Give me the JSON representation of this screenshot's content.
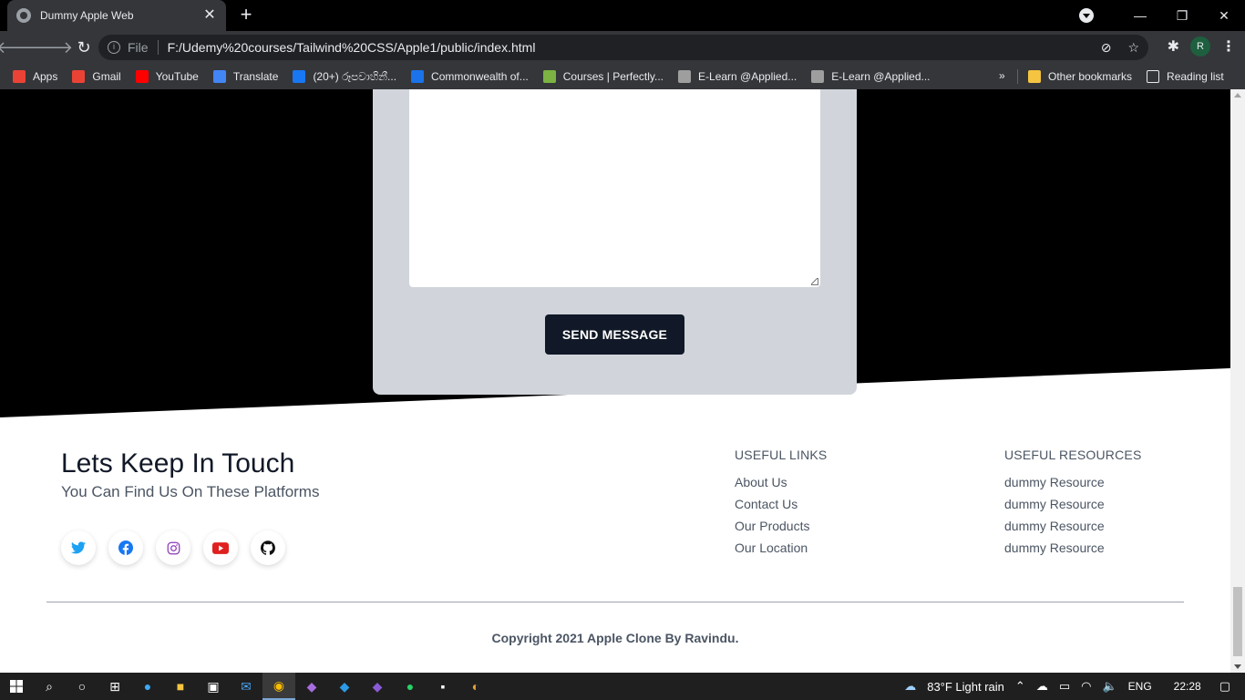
{
  "browser": {
    "tab_title": "Dummy Apple Web",
    "tab_close": "✕",
    "new_tab": "+",
    "scheme_label": "File",
    "url": "F:/Udemy%20courses/Tailwind%20CSS/Apple1/public/index.html",
    "profile_initial": "R",
    "bookmarks": [
      {
        "label": "Apps",
        "color": "#ea4335"
      },
      {
        "label": "Gmail",
        "color": "#ea4335"
      },
      {
        "label": "YouTube",
        "color": "#ff0000"
      },
      {
        "label": "Translate",
        "color": "#4285f4"
      },
      {
        "label": "(20+) රූපවාහිනී...",
        "color": "#1877f2"
      },
      {
        "label": "Commonwealth of...",
        "color": "#1a73e8"
      },
      {
        "label": "Courses | Perfectly...",
        "color": "#7cb342"
      },
      {
        "label": "E-Learn @Applied...",
        "color": "#9e9e9e"
      },
      {
        "label": "E-Learn @Applied...",
        "color": "#9e9e9e"
      }
    ],
    "bookmarks_more": "»",
    "other_bookmarks": "Other bookmarks",
    "reading_list": "Reading list"
  },
  "form": {
    "send_label": "SEND MESSAGE"
  },
  "footer": {
    "title": "Lets Keep In Touch",
    "subtitle": "You Can Find Us On These Platforms",
    "socials": [
      {
        "name": "twitter",
        "color": "#1da1f2"
      },
      {
        "name": "facebook",
        "color": "#1877f2"
      },
      {
        "name": "instagram",
        "color": "#8a3ab9"
      },
      {
        "name": "youtube",
        "color": "#e02020"
      },
      {
        "name": "github",
        "color": "#111111"
      }
    ],
    "useful_links": {
      "heading": "Useful Links",
      "items": [
        "About Us",
        "Contact Us",
        "Our Products",
        "Our Location"
      ]
    },
    "useful_resources": {
      "heading": "Useful Resources",
      "items": [
        "dummy Resource",
        "dummy Resource",
        "dummy Resource",
        "dummy Resource"
      ]
    },
    "copyright": "Copyright 2021 Apple Clone By Ravindu."
  },
  "taskbar": {
    "weather": "83°F  Light rain",
    "language": "ENG",
    "time": "22:28"
  }
}
